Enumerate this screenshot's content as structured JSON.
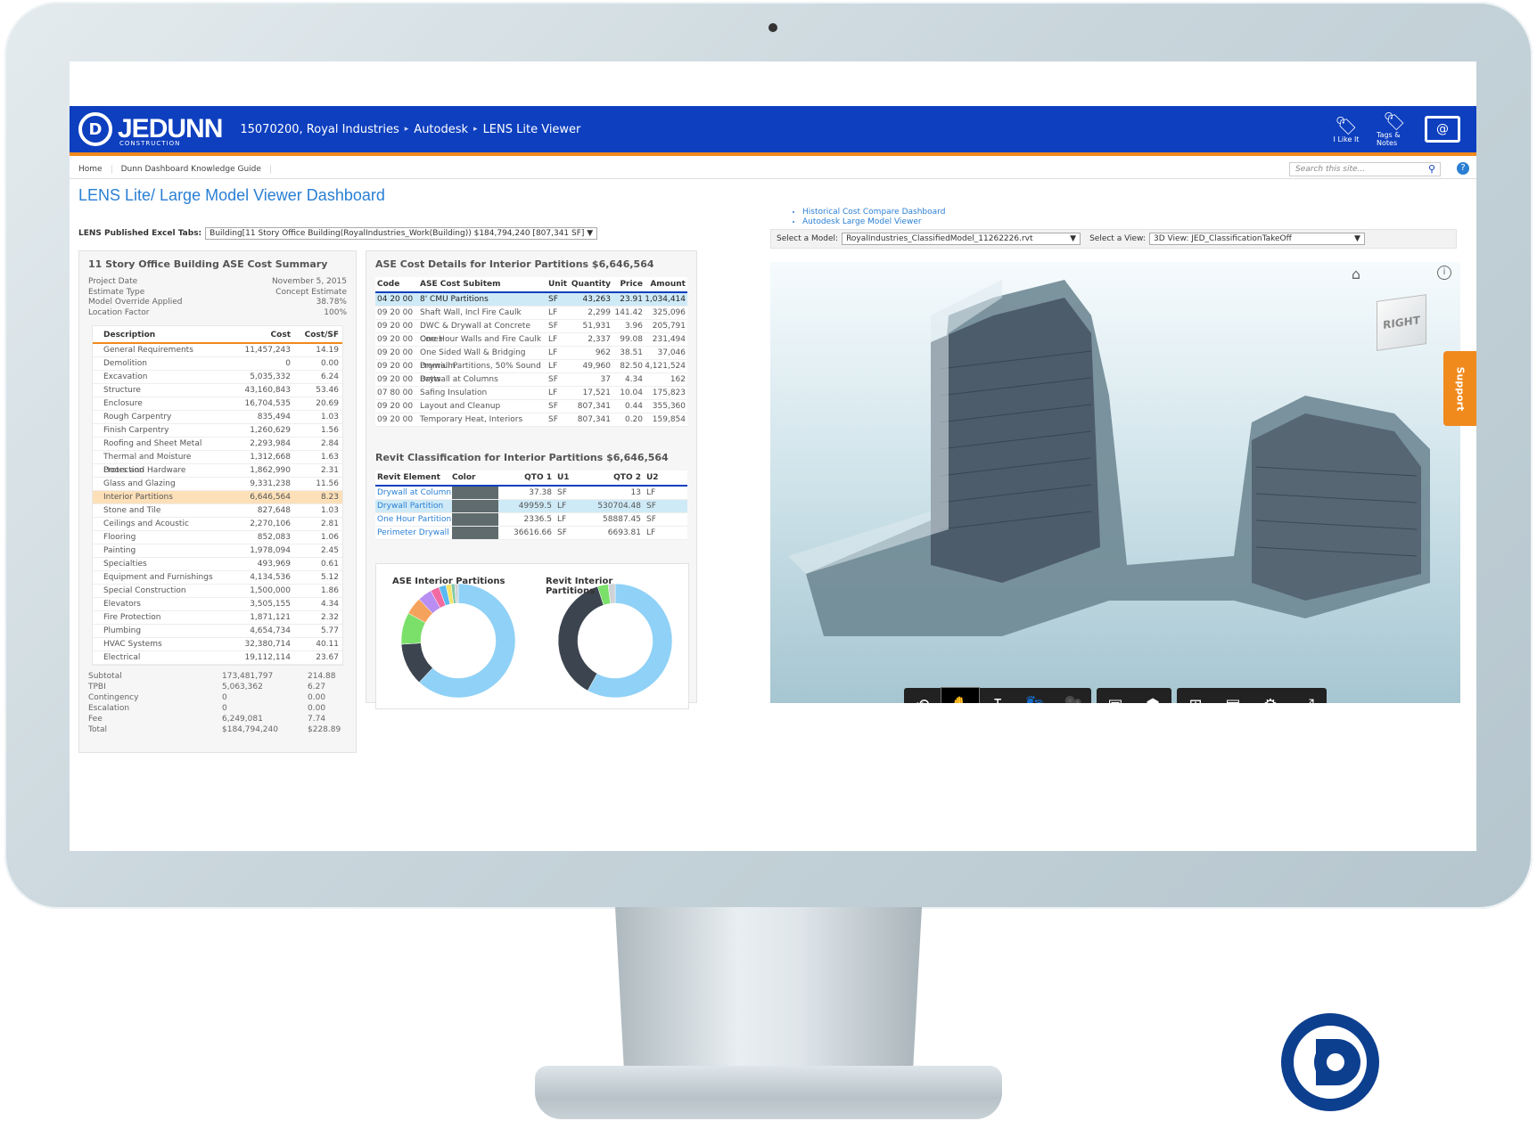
{
  "header": {
    "brand": "JEDUNN",
    "brand_sub": "CONSTRUCTION",
    "breadcrumbs": [
      "15070200, Royal Industries",
      "Autodesk",
      "LENS Lite Viewer"
    ],
    "icons": [
      {
        "name": "i-like-it-icon",
        "label": "I Like It",
        "glyph": "🏷"
      },
      {
        "name": "tags-notes-icon",
        "label": "Tags & Notes",
        "glyph": "🏷"
      }
    ]
  },
  "nav": {
    "items": [
      "Home",
      "Dunn Dashboard Knowledge Guide"
    ],
    "search_placeholder": "Search this site..."
  },
  "page": {
    "title": "LENS Lite/ Large Model Viewer Dashboard",
    "excel_label": "LENS Published Excel Tabs:",
    "excel_value": "Building[11 Story Office Building(RoyalIndustries_Work(Building)) $184,794,240 [807,341 SF]",
    "links": [
      "Historical Cost Compare Dashboard",
      "Autodesk Large Model Viewer"
    ]
  },
  "summary": {
    "title": "11 Story Office Building ASE Cost Summary",
    "meta": [
      {
        "label": "Project Date",
        "value": "November 5, 2015"
      },
      {
        "label": "Estimate Type",
        "value": "Concept Estimate"
      },
      {
        "label": "Model Override Applied",
        "value": "38.78%"
      },
      {
        "label": "Location Factor",
        "value": "100%"
      }
    ],
    "headers": {
      "desc": "Description",
      "cost": "Cost",
      "csf": "Cost/SF"
    },
    "rows": [
      {
        "desc": "General Requirements",
        "cost": "11,457,243",
        "csf": "14.19"
      },
      {
        "desc": "Demolition",
        "cost": "0",
        "csf": "0.00"
      },
      {
        "desc": "Excavation",
        "cost": "5,035,332",
        "csf": "6.24"
      },
      {
        "desc": "Structure",
        "cost": "43,160,843",
        "csf": "53.46"
      },
      {
        "desc": "Enclosure",
        "cost": "16,704,535",
        "csf": "20.69"
      },
      {
        "desc": "Rough Carpentry",
        "cost": "835,494",
        "csf": "1.03"
      },
      {
        "desc": "Finish Carpentry",
        "cost": "1,260,629",
        "csf": "1.56"
      },
      {
        "desc": "Roofing and Sheet Metal",
        "cost": "2,293,984",
        "csf": "2.84"
      },
      {
        "desc": "Thermal and Moisture Protection",
        "cost": "1,312,668",
        "csf": "1.63"
      },
      {
        "desc": "Doors and Hardware",
        "cost": "1,862,990",
        "csf": "2.31"
      },
      {
        "desc": "Glass and Glazing",
        "cost": "9,331,238",
        "csf": "11.56"
      },
      {
        "desc": "Interior Partitions",
        "cost": "6,646,564",
        "csf": "8.23",
        "highlight": true
      },
      {
        "desc": "Stone and Tile",
        "cost": "827,648",
        "csf": "1.03"
      },
      {
        "desc": "Ceilings and Acoustic",
        "cost": "2,270,106",
        "csf": "2.81"
      },
      {
        "desc": "Flooring",
        "cost": "852,083",
        "csf": "1.06"
      },
      {
        "desc": "Painting",
        "cost": "1,978,094",
        "csf": "2.45"
      },
      {
        "desc": "Specialties",
        "cost": "493,969",
        "csf": "0.61"
      },
      {
        "desc": "Equipment and Furnishings",
        "cost": "4,134,536",
        "csf": "5.12"
      },
      {
        "desc": "Special Construction",
        "cost": "1,500,000",
        "csf": "1.86"
      },
      {
        "desc": "Elevators",
        "cost": "3,505,155",
        "csf": "4.34"
      },
      {
        "desc": "Fire Protection",
        "cost": "1,871,121",
        "csf": "2.32"
      },
      {
        "desc": "Plumbing",
        "cost": "4,654,734",
        "csf": "5.77"
      },
      {
        "desc": "HVAC Systems",
        "cost": "32,380,714",
        "csf": "40.11"
      },
      {
        "desc": "Electrical",
        "cost": "19,112,114",
        "csf": "23.67"
      }
    ],
    "totals": [
      {
        "label": "Subtotal",
        "cost": "173,481,797",
        "csf": "214.88"
      },
      {
        "label": "TPBI",
        "cost": "5,063,362",
        "csf": "6.27"
      },
      {
        "label": "Contingency",
        "cost": "0",
        "csf": "0.00"
      },
      {
        "label": "Escalation",
        "cost": "0",
        "csf": "0.00"
      },
      {
        "label": "Fee",
        "cost": "6,249,081",
        "csf": "7.74"
      },
      {
        "label": "Total",
        "cost": "$184,794,240",
        "csf": "$228.89"
      }
    ]
  },
  "details": {
    "title": "ASE Cost Details for Interior Partitions $6,646,564",
    "headers": {
      "code": "Code",
      "sub": "ASE Cost Subitem",
      "unit": "Unit",
      "qty": "Quantity",
      "price": "Price",
      "amt": "Amount"
    },
    "rows": [
      {
        "code": "04 20 00",
        "sub": "8' CMU Partitions",
        "unit": "SF",
        "qty": "43,263",
        "price": "23.91",
        "amt": "1,034,414",
        "selected": true
      },
      {
        "code": "09 20 00",
        "sub": "Shaft Wall, Incl Fire Caulk",
        "unit": "LF",
        "qty": "2,299",
        "price": "141.42",
        "amt": "325,096"
      },
      {
        "code": "09 20 00",
        "sub": "DWC & Drywall at Concrete Cores",
        "unit": "SF",
        "qty": "51,931",
        "price": "3.96",
        "amt": "205,791"
      },
      {
        "code": "09 20 00",
        "sub": "One Hour Walls and Fire Caulk",
        "unit": "LF",
        "qty": "2,337",
        "price": "99.08",
        "amt": "231,494"
      },
      {
        "code": "09 20 00",
        "sub": "One Sided Wall & Bridging Premium",
        "unit": "LF",
        "qty": "962",
        "price": "38.51",
        "amt": "37,046"
      },
      {
        "code": "09 20 00",
        "sub": "Drywall Partitions, 50% Sound Batts",
        "unit": "LF",
        "qty": "49,960",
        "price": "82.50",
        "amt": "4,121,524"
      },
      {
        "code": "09 20 00",
        "sub": "Drywall at Columns",
        "unit": "SF",
        "qty": "37",
        "price": "4.34",
        "amt": "162"
      },
      {
        "code": "07 80 00",
        "sub": "Safing Insulation",
        "unit": "LF",
        "qty": "17,521",
        "price": "10.04",
        "amt": "175,823"
      },
      {
        "code": "09 20 00",
        "sub": "Layout and Cleanup",
        "unit": "SF",
        "qty": "807,341",
        "price": "0.44",
        "amt": "355,360"
      },
      {
        "code": "09 20 00",
        "sub": "Temporary Heat, Interiors",
        "unit": "SF",
        "qty": "807,341",
        "price": "0.20",
        "amt": "159,854"
      }
    ]
  },
  "revit": {
    "title": "Revit Classification for Interior Partitions $6,646,564",
    "headers": {
      "el": "Revit Element",
      "color": "Color",
      "q1": "QTO 1",
      "u1": "U1",
      "q2": "QTO 2",
      "u2": "U2"
    },
    "rows": [
      {
        "el": "Drywall at Column",
        "q1": "37.38",
        "u1": "SF",
        "q2": "13",
        "u2": "LF"
      },
      {
        "el": "Drywall Partition",
        "q1": "49959.5",
        "u1": "LF",
        "q2": "530704.48",
        "u2": "SF",
        "selected": true
      },
      {
        "el": "One Hour Partition",
        "q1": "2336.5",
        "u1": "LF",
        "q2": "58887.45",
        "u2": "SF"
      },
      {
        "el": "Perimeter Drywall",
        "q1": "36616.66",
        "u1": "SF",
        "q2": "6693.81",
        "u2": "LF"
      }
    ]
  },
  "chart_data": [
    {
      "type": "pie",
      "title": "ASE Interior Partitions",
      "donut": true,
      "values": [
        62,
        12,
        9,
        5,
        4,
        2.5,
        2,
        1.5,
        1,
        1
      ],
      "colors": [
        "#8fd1f7",
        "#3c4450",
        "#7be06a",
        "#f5a35c",
        "#b98ef2",
        "#f26aa2",
        "#5bb8f2",
        "#f5e36a",
        "#7fc9a6",
        "#cfd3d6"
      ]
    },
    {
      "type": "pie",
      "title": "Revit Interior Partitions",
      "donut": true,
      "values": [
        58,
        37,
        3,
        2
      ],
      "colors": [
        "#8fd1f7",
        "#3c4450",
        "#7be06a",
        "#cfd3d6"
      ]
    }
  ],
  "viewer": {
    "model_label": "Select a Model:",
    "model_value": "RoyalIndustries_ClassifiedModel_11262226.rvt",
    "view_label": "Select a View:",
    "view_value": "3D View: JED_ClassificationTakeOff",
    "viewcube": "RIGHT",
    "support": "Support",
    "tools": [
      {
        "name": "orbit-icon",
        "glyph": "⟲"
      },
      {
        "name": "pan-icon",
        "glyph": "✋",
        "active": true
      },
      {
        "name": "zoom-icon",
        "glyph": "↧"
      },
      {
        "name": "walk-icon",
        "glyph": "👣"
      },
      {
        "name": "camera-icon",
        "glyph": "🎥"
      },
      {
        "name": "section-icon",
        "glyph": "▣"
      },
      {
        "name": "explode-icon",
        "glyph": "⬢"
      },
      {
        "name": "model-browser-icon",
        "glyph": "⊞"
      },
      {
        "name": "properties-icon",
        "glyph": "▤"
      },
      {
        "name": "settings-icon",
        "glyph": "⚙"
      },
      {
        "name": "fullscreen-icon",
        "glyph": "⤢"
      }
    ]
  }
}
